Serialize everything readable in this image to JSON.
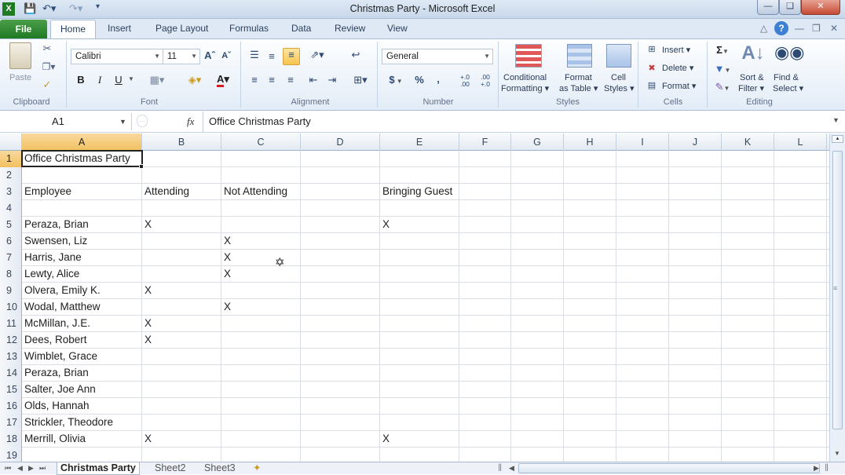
{
  "window": {
    "title": "Christmas Party - Microsoft Excel"
  },
  "tabs": {
    "file": "File",
    "home": "Home",
    "insert": "Insert",
    "page_layout": "Page Layout",
    "formulas": "Formulas",
    "data": "Data",
    "review": "Review",
    "view": "View"
  },
  "ribbon": {
    "clipboard": {
      "paste": "Paste",
      "label": "Clipboard"
    },
    "font": {
      "name": "Calibri",
      "size": "11",
      "bold": "B",
      "italic": "I",
      "underline": "U",
      "label": "Font"
    },
    "alignment": {
      "label": "Alignment"
    },
    "number": {
      "format": "General",
      "dollar": "$",
      "percent": "%",
      "comma": ",",
      "inc_decimal": "+.0 .00",
      "dec_decimal": ".00 +.0",
      "label": "Number"
    },
    "styles": {
      "conditional_1": "Conditional",
      "conditional_2": "Formatting",
      "format_table_1": "Format",
      "format_table_2": "as Table",
      "cell_styles_1": "Cell",
      "cell_styles_2": "Styles",
      "label": "Styles"
    },
    "cells": {
      "insert": "Insert",
      "delete": "Delete",
      "format": "Format",
      "label": "Cells"
    },
    "editing": {
      "sort_1": "Sort &",
      "sort_2": "Filter",
      "find_1": "Find &",
      "find_2": "Select",
      "label": "Editing"
    }
  },
  "formula_bar": {
    "name_box": "A1",
    "fx": "fx",
    "value": "Office Christmas Party"
  },
  "columns": [
    "A",
    "B",
    "C",
    "D",
    "E",
    "F",
    "G",
    "H",
    "I",
    "J",
    "K",
    "L"
  ],
  "rows": [
    {
      "num": "1",
      "A": "Office Christmas Party",
      "B": "",
      "C": "",
      "E": ""
    },
    {
      "num": "2",
      "A": "",
      "B": "",
      "C": "",
      "E": ""
    },
    {
      "num": "3",
      "A": "Employee",
      "B": "Attending",
      "C": "Not Attending",
      "E": "Bringing Guest"
    },
    {
      "num": "4",
      "A": "",
      "B": "",
      "C": "",
      "E": ""
    },
    {
      "num": "5",
      "A": "Peraza, Brian",
      "B": "X",
      "C": "",
      "E": "X"
    },
    {
      "num": "6",
      "A": "Swensen, Liz",
      "B": "",
      "C": "X",
      "E": ""
    },
    {
      "num": "7",
      "A": "Harris, Jane",
      "B": "",
      "C": "X",
      "E": ""
    },
    {
      "num": "8",
      "A": "Lewty, Alice",
      "B": "",
      "C": "X",
      "E": ""
    },
    {
      "num": "9",
      "A": "Olvera, Emily K.",
      "B": "X",
      "C": "",
      "E": ""
    },
    {
      "num": "10",
      "A": "Wodal, Matthew",
      "B": "",
      "C": "X",
      "E": ""
    },
    {
      "num": "11",
      "A": "McMillan, J.E.",
      "B": "X",
      "C": "",
      "E": ""
    },
    {
      "num": "12",
      "A": "Dees, Robert",
      "B": "X",
      "C": "",
      "E": ""
    },
    {
      "num": "13",
      "A": "Wimblet, Grace",
      "B": "",
      "C": "",
      "E": ""
    },
    {
      "num": "14",
      "A": "Peraza, Brian",
      "B": "",
      "C": "",
      "E": ""
    },
    {
      "num": "15",
      "A": "Salter, Joe Ann",
      "B": "",
      "C": "",
      "E": ""
    },
    {
      "num": "16",
      "A": "Olds, Hannah",
      "B": "",
      "C": "",
      "E": ""
    },
    {
      "num": "17",
      "A": "Strickler, Theodore",
      "B": "",
      "C": "",
      "E": ""
    },
    {
      "num": "18",
      "A": "Merrill, Olivia",
      "B": "X",
      "C": "",
      "E": "X"
    },
    {
      "num": "19",
      "A": "",
      "B": "",
      "C": "",
      "E": ""
    }
  ],
  "sheets": [
    "Christmas Party",
    "Sheet2",
    "Sheet3"
  ],
  "colors": {
    "selection": "#f1c15f",
    "file_tab": "#1f7a24",
    "ribbon": "#e3ecf7"
  }
}
